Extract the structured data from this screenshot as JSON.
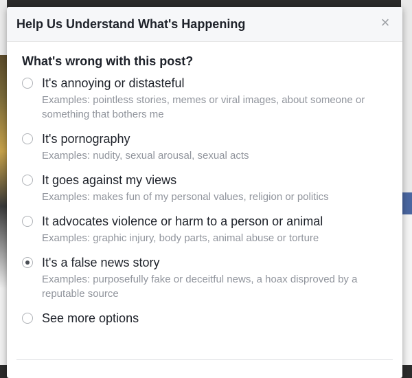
{
  "dialog": {
    "title": "Help Us Understand What's Happening",
    "close_glyph": "×"
  },
  "question": "What's wrong with this post?",
  "options": [
    {
      "label": "It's annoying or distasteful",
      "example": "Examples: pointless stories, memes or viral images, about someone or something that bothers me",
      "checked": false
    },
    {
      "label": "It's pornography",
      "example": "Examples: nudity, sexual arousal, sexual acts",
      "checked": false
    },
    {
      "label": "It goes against my views",
      "example": "Examples: makes fun of my personal values, religion or politics",
      "checked": false
    },
    {
      "label": "It advocates violence or harm to a person or animal",
      "example": "Examples: graphic injury, body parts, animal abuse or torture",
      "checked": false
    },
    {
      "label": "It's a false news story",
      "example": "Examples: purposefully fake or deceitful news, a hoax disproved by a reputable source",
      "checked": true
    },
    {
      "label": "See more options",
      "example": "",
      "checked": false
    }
  ]
}
